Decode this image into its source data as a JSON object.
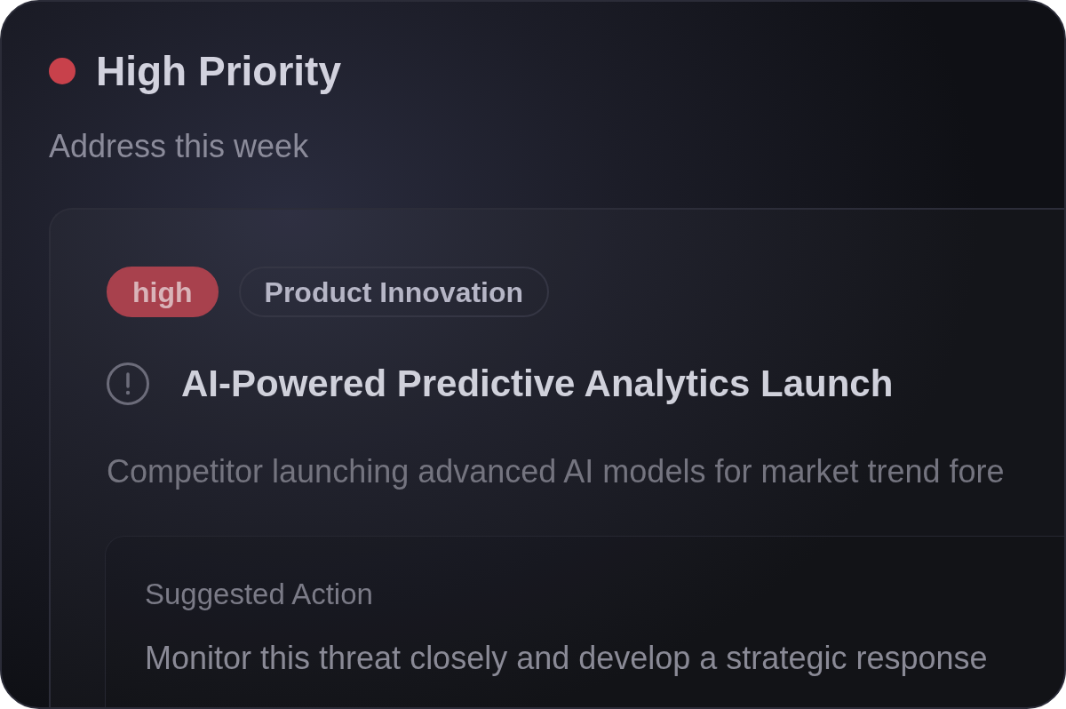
{
  "section": {
    "color": "#c8414b",
    "title": "High Priority",
    "subtitle": "Address this week"
  },
  "alert": {
    "tags": [
      {
        "kind": "priority",
        "label": "high"
      },
      {
        "kind": "category",
        "label": "Product Innovation"
      }
    ],
    "title": "AI-Powered Predictive Analytics Launch",
    "description": "Competitor launching advanced AI models for market trend fore",
    "suggested_action": {
      "label": "Suggested Action",
      "text": "Monitor this threat closely and develop a strategic response"
    }
  }
}
